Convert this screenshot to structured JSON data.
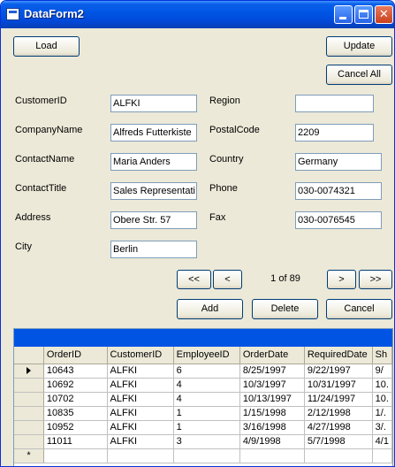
{
  "window": {
    "title": "DataForm2"
  },
  "buttons": {
    "load": "Load",
    "update": "Update",
    "cancel_all": "Cancel All",
    "first": "<<",
    "prev": "<",
    "next": ">",
    "last": ">>",
    "add": "Add",
    "delete": "Delete",
    "cancel": "Cancel"
  },
  "fields": {
    "customer_id": {
      "label": "CustomerID",
      "value": "ALFKI"
    },
    "company_name": {
      "label": "CompanyName",
      "value": "Alfreds Futterkiste"
    },
    "contact_name": {
      "label": "ContactName",
      "value": "Maria Anders"
    },
    "contact_title": {
      "label": "ContactTitle",
      "value": "Sales Representati"
    },
    "address": {
      "label": "Address",
      "value": "Obere Str. 57"
    },
    "city": {
      "label": "City",
      "value": "Berlin"
    },
    "region": {
      "label": "Region",
      "value": ""
    },
    "postal_code": {
      "label": "PostalCode",
      "value": "2209"
    },
    "country": {
      "label": "Country",
      "value": "Germany"
    },
    "phone": {
      "label": "Phone",
      "value": "030-0074321"
    },
    "fax": {
      "label": "Fax",
      "value": "030-0076545"
    }
  },
  "navigator": {
    "position": "1 of  89"
  },
  "grid": {
    "columns": [
      "OrderID",
      "CustomerID",
      "EmployeeID",
      "OrderDate",
      "RequiredDate",
      "Sh"
    ],
    "rows": [
      [
        "10643",
        "ALFKI",
        "6",
        "8/25/1997",
        "9/22/1997",
        "9/"
      ],
      [
        "10692",
        "ALFKI",
        "4",
        "10/3/1997",
        "10/31/1997",
        "10."
      ],
      [
        "10702",
        "ALFKI",
        "4",
        "10/13/1997",
        "11/24/1997",
        "10."
      ],
      [
        "10835",
        "ALFKI",
        "1",
        "1/15/1998",
        "2/12/1998",
        "1/."
      ],
      [
        "10952",
        "ALFKI",
        "1",
        "3/16/1998",
        "4/27/1998",
        "3/."
      ],
      [
        "11011",
        "ALFKI",
        "3",
        "4/9/1998",
        "5/7/1998",
        "4/1"
      ]
    ],
    "new_row_marker": "*"
  },
  "colors": {
    "titlebar": "#0054e3",
    "window_bg": "#ece9d8",
    "grid_caption": "#0054e3"
  }
}
